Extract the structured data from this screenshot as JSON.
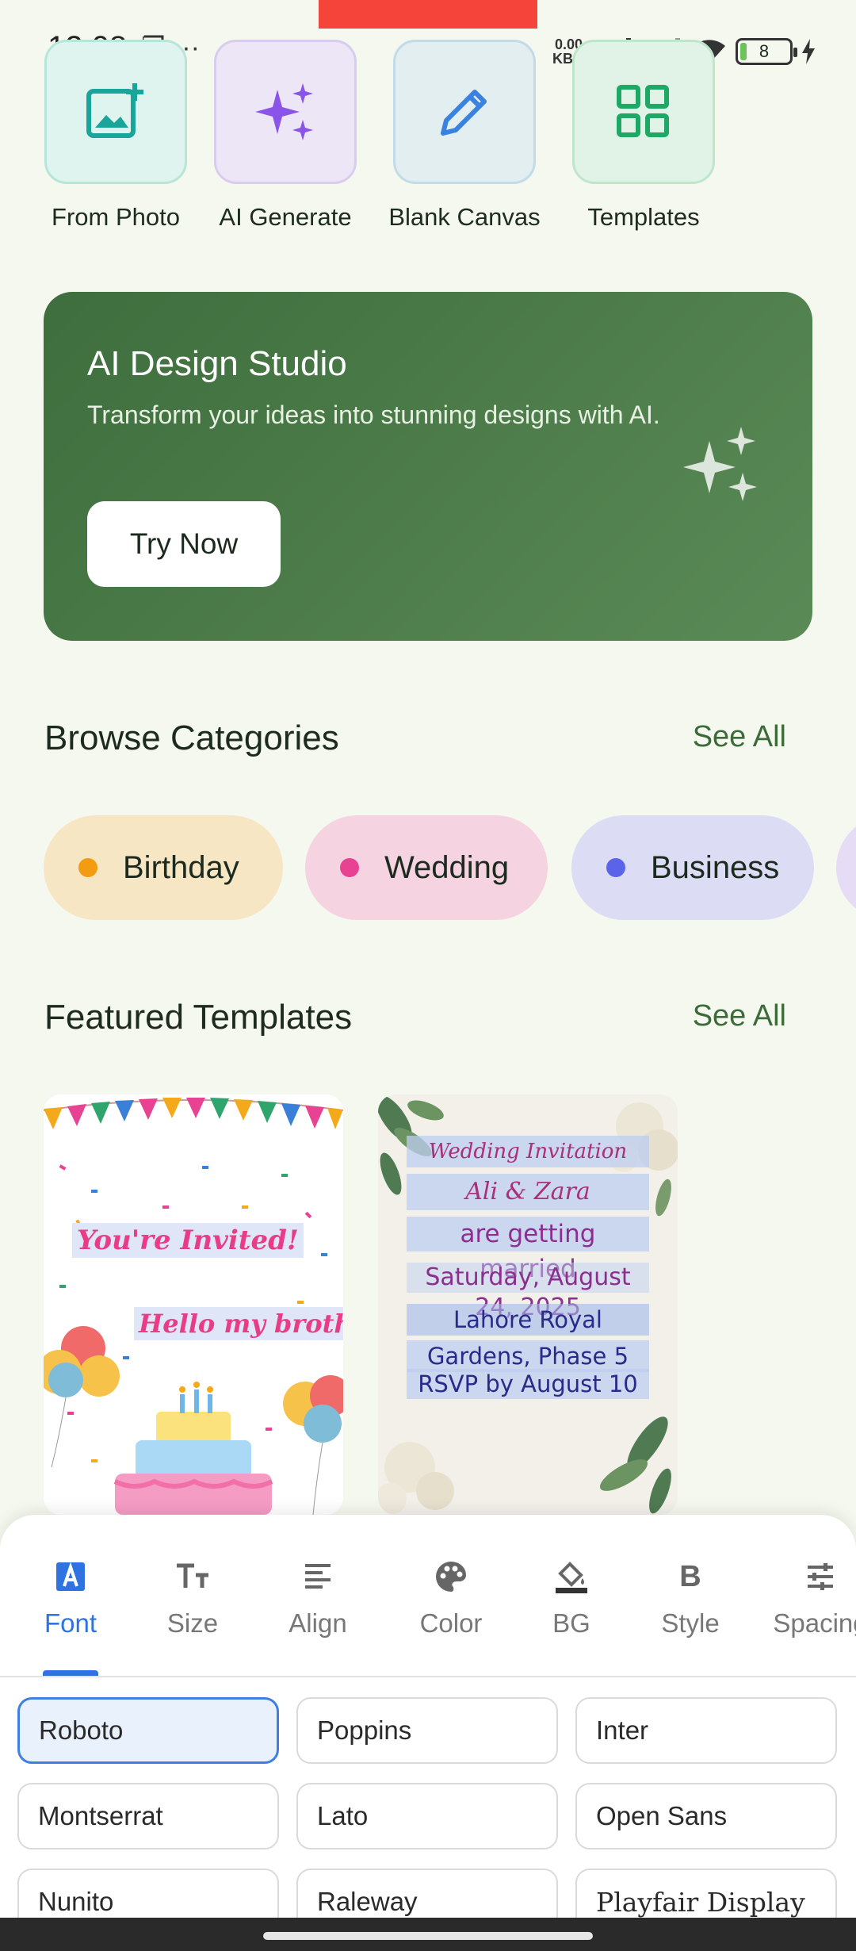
{
  "status": {
    "time": "12:08",
    "left_icons": "❐ ···",
    "net_speed_value": "0.00",
    "net_speed_unit": "KB/s",
    "battery": "8"
  },
  "quick_actions": [
    {
      "label": "From Photo",
      "icon": "add-photo-icon",
      "color": "#1aa59b"
    },
    {
      "label": "AI Generate",
      "icon": "sparkles-icon",
      "color": "#8b54e8"
    },
    {
      "label": "Blank Canvas",
      "icon": "pencil-icon",
      "color": "#3a82e0"
    },
    {
      "label": "Templates",
      "icon": "grid-icon",
      "color": "#1ea866"
    }
  ],
  "promo": {
    "title": "AI Design Studio",
    "subtitle": "Transform your ideas into stunning designs with AI.",
    "button": "Try Now"
  },
  "categories": {
    "title": "Browse Categories",
    "see_all": "See All",
    "items": [
      {
        "label": "Birthday",
        "dot": "#f39c12",
        "bg": "#f7e6c4"
      },
      {
        "label": "Wedding",
        "dot": "#e84393",
        "bg": "#f5d3e0"
      },
      {
        "label": "Business",
        "dot": "#5b63e8",
        "bg": "#dcdcf5"
      }
    ]
  },
  "featured": {
    "title": "Featured Templates",
    "see_all": "See All",
    "birthday": {
      "line1": "You're Invited!",
      "line2": "Hello my brother"
    },
    "wedding": {
      "title": "Wedding Invitation",
      "names": "Ali & Zara",
      "line1": "are getting",
      "line2": "married",
      "date": "Saturday, August",
      "date2": "24, 2025",
      "venue1": "Lahore Royal",
      "venue2": "Gardens, Phase 5",
      "rsvp": "RSVP by August 10"
    }
  },
  "editor": {
    "tabs": [
      {
        "label": "Font",
        "icon": "font-icon"
      },
      {
        "label": "Size",
        "icon": "text-size-icon"
      },
      {
        "label": "Align",
        "icon": "align-icon"
      },
      {
        "label": "Color",
        "icon": "palette-icon"
      },
      {
        "label": "BG",
        "icon": "paint-bucket-icon"
      },
      {
        "label": "Style",
        "icon": "bold-icon"
      },
      {
        "label": "Spacing",
        "icon": "tune-icon"
      }
    ],
    "active_tab": "Font",
    "fonts": [
      "Roboto",
      "Poppins",
      "Inter",
      "Montserrat",
      "Lato",
      "Open Sans",
      "Nunito",
      "Raleway",
      "Playfair Display"
    ],
    "selected_font": "Roboto"
  }
}
